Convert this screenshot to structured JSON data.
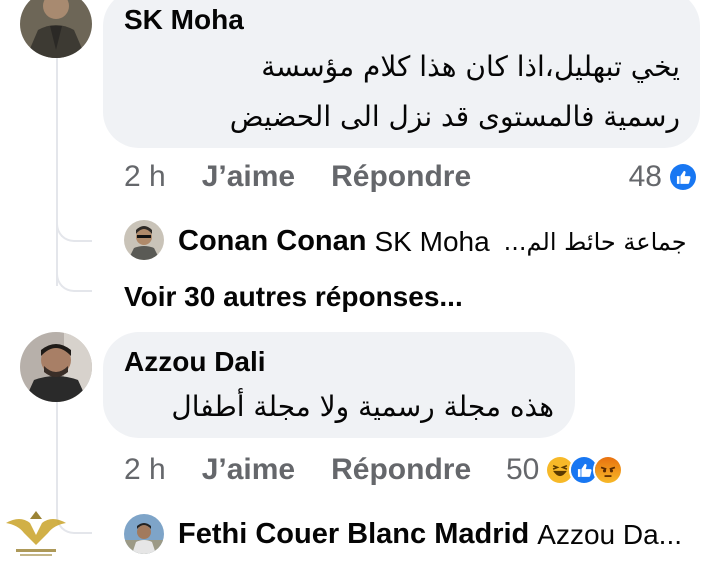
{
  "comments": [
    {
      "author": "SK Moha",
      "text_lines": [
        "يخي تبهليل،اذا كان هذا كلام مؤسسة",
        "رسمية فالمستوى قد نزل الى الحضيض"
      ],
      "time": "2 h",
      "like_label": "J’aime",
      "reply_label": "Répondre",
      "reaction_count": "48",
      "reactions": [
        "like-icon"
      ],
      "replies": {
        "preview": {
          "author": "Conan Conan",
          "mention": "SK Moha",
          "text": "جماعة حائط الم..."
        },
        "see_more": "Voir 30 autres réponses..."
      }
    },
    {
      "author": "Azzou Dali",
      "text_lines": [
        "هذه مجلة رسمية ولا مجلة أطفال"
      ],
      "time": "2 h",
      "like_label": "J’aime",
      "reply_label": "Répondre",
      "reaction_count": "50",
      "reactions": [
        "haha-icon",
        "like-icon",
        "angry-icon"
      ],
      "replies": {
        "preview": {
          "author": "Fethi Couer Blanc Madrid",
          "mention": "Azzou Da..."
        }
      }
    }
  ],
  "colors": {
    "bubble": "#f0f2f5",
    "secondary_text": "#65676b",
    "like_blue": "#1877f2",
    "thread_line": "#e4e6eb"
  }
}
